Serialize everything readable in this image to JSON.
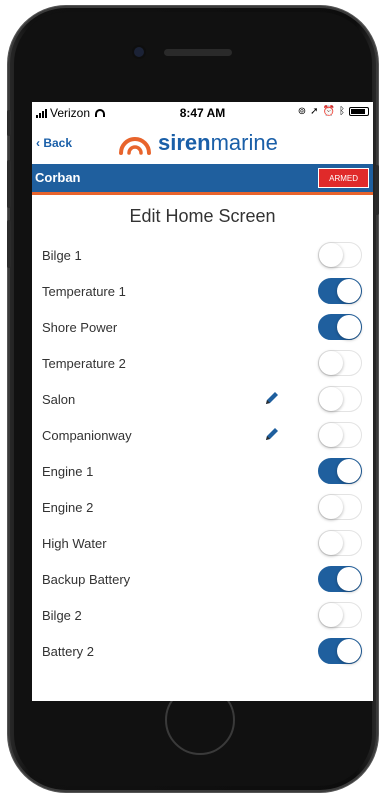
{
  "status_bar": {
    "carrier": "Verizon",
    "time": "8:47 AM",
    "icons": [
      "lock-rotation-icon",
      "location-icon",
      "alarm-icon",
      "bluetooth-icon",
      "battery-icon"
    ]
  },
  "nav": {
    "back_label": "Back",
    "logo_bold": "siren",
    "logo_light": "marine"
  },
  "banner": {
    "title": "Corban",
    "armed_label": "ARMED",
    "color": "#1f5f9e",
    "accent": "#e8642c",
    "armed_color": "#e02a2a"
  },
  "screen_title": "Edit Home Screen",
  "items": [
    {
      "label": "Bilge 1",
      "on": false,
      "editable": false
    },
    {
      "label": "Temperature 1",
      "on": true,
      "editable": false
    },
    {
      "label": "Shore Power",
      "on": true,
      "editable": false
    },
    {
      "label": "Temperature 2",
      "on": false,
      "editable": false
    },
    {
      "label": "Salon",
      "on": false,
      "editable": true
    },
    {
      "label": "Companionway",
      "on": false,
      "editable": true
    },
    {
      "label": "Engine 1",
      "on": true,
      "editable": false
    },
    {
      "label": "Engine 2",
      "on": false,
      "editable": false
    },
    {
      "label": "High Water",
      "on": false,
      "editable": false
    },
    {
      "label": "Backup Battery",
      "on": true,
      "editable": false
    },
    {
      "label": "Bilge 2",
      "on": false,
      "editable": false
    },
    {
      "label": "Battery 2",
      "on": true,
      "editable": false
    }
  ]
}
